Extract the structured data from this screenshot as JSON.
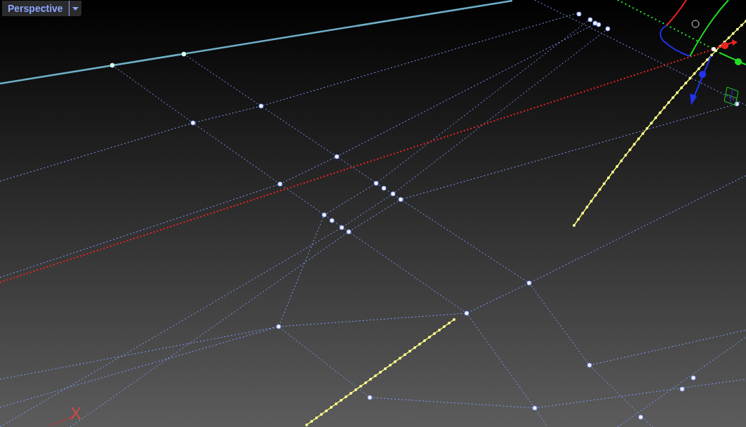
{
  "viewport": {
    "title": "Perspective",
    "axis_label": "X"
  }
}
